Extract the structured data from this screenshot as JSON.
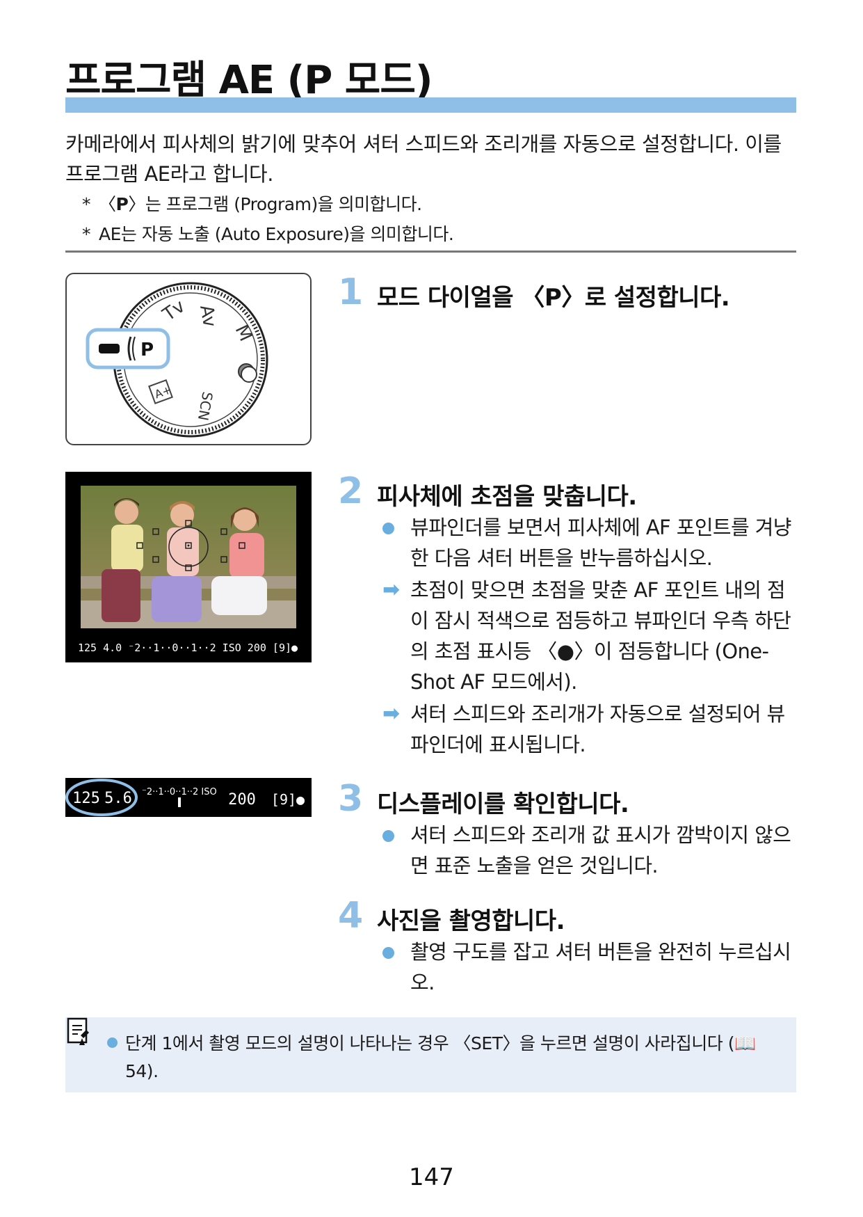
{
  "title": "프로그램 AE (P 모드)",
  "intro": "카메라에서 피사체의 밝기에 맞추어 셔터 스피드와 조리개를 자동으로 설정합니다. 이를 프로그램 AE라고 합니다.",
  "notes": [
    {
      "star": "*",
      "pre": "〈",
      "sym": "P",
      "post": "〉는 프로그램 (Program)을 의미합니다."
    },
    {
      "star": "*",
      "text": "AE는 자동 노출 (Auto Exposure)을 의미합니다."
    }
  ],
  "dial": {
    "labels": {
      "tv": "Tv",
      "av": "Av",
      "m": "M",
      "p": "P",
      "scn": "SCN",
      "aplus": "A+"
    }
  },
  "viewfinder": {
    "readout": "125  4.0  ⁻2··1··0··1··2 ISO  200  [9]●"
  },
  "status_display": {
    "shutter": "125",
    "aperture": "5.6",
    "scale": "⁻2··1··0··1··2 ISO",
    "iso": "200",
    "shots": "[9]●"
  },
  "steps": [
    {
      "num": "1",
      "title": "모드 다이얼을 〈P〉로 설정합니다.",
      "bullets": []
    },
    {
      "num": "2",
      "title": "피사체에 초점을 맞춥니다.",
      "bullets": [
        {
          "mark": "dot",
          "text": "뷰파인더를 보면서 피사체에 AF 포인트를 겨냥한 다음 셔터 버튼을 반누름하십시오."
        },
        {
          "mark": "arrow",
          "text": "초점이 맞으면 초점을 맞춘 AF 포인트 내의 점이 잠시 적색으로 점등하고 뷰파인더 우측 하단의 초점 표시등 〈●〉이 점등합니다 (One-Shot AF 모드에서)."
        },
        {
          "mark": "arrow",
          "text": "셔터 스피드와 조리개가 자동으로 설정되어 뷰파인더에 표시됩니다."
        }
      ]
    },
    {
      "num": "3",
      "title": "디스플레이를 확인합니다.",
      "bullets": [
        {
          "mark": "dot",
          "text": "셔터 스피드와 조리개 값 표시가 깜박이지 않으면 표준 노출을 얻은 것입니다."
        }
      ]
    },
    {
      "num": "4",
      "title": "사진을 촬영합니다.",
      "bullets": [
        {
          "mark": "dot",
          "text": "촬영 구도를 잡고 셔터 버튼을 완전히 누르십시오."
        }
      ]
    }
  ],
  "tip": "단계 1에서 촬영 모드의 설명이 나타나는 경우 〈SET〉을 누르면 설명이 사라집니다 (📖54).",
  "page_number": "147",
  "colors": {
    "accent": "#8fbfe6",
    "bullet": "#6aaee0",
    "tip_bg": "#e8eef8"
  }
}
